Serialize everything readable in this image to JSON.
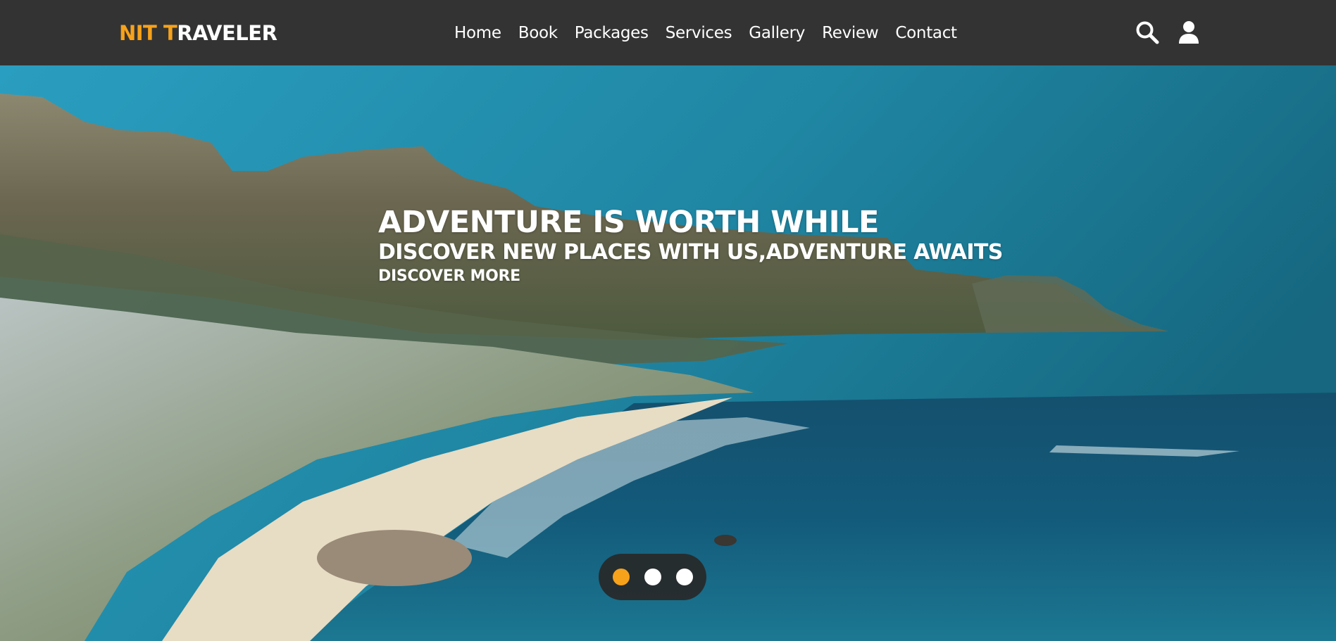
{
  "brand": {
    "accent_text": "NIT T",
    "rest_text": "RAVELER",
    "accent_color": "#f7a21b"
  },
  "nav": {
    "items": [
      "Home",
      "Book",
      "Packages",
      "Services",
      "Gallery",
      "Review",
      "Contact"
    ]
  },
  "header_icons": [
    "search-icon",
    "user-icon"
  ],
  "hero": {
    "title": "ADVENTURE IS WORTH WHILE",
    "subtitle": "DISCOVER NEW PLACES WITH US,ADVENTURE AWAITS",
    "link_label": "DISCOVER MORE"
  },
  "slider": {
    "count": 3,
    "active_index": 0
  },
  "colors": {
    "header_bg": "#333333",
    "accent": "#f7a21b",
    "text": "#ffffff"
  }
}
